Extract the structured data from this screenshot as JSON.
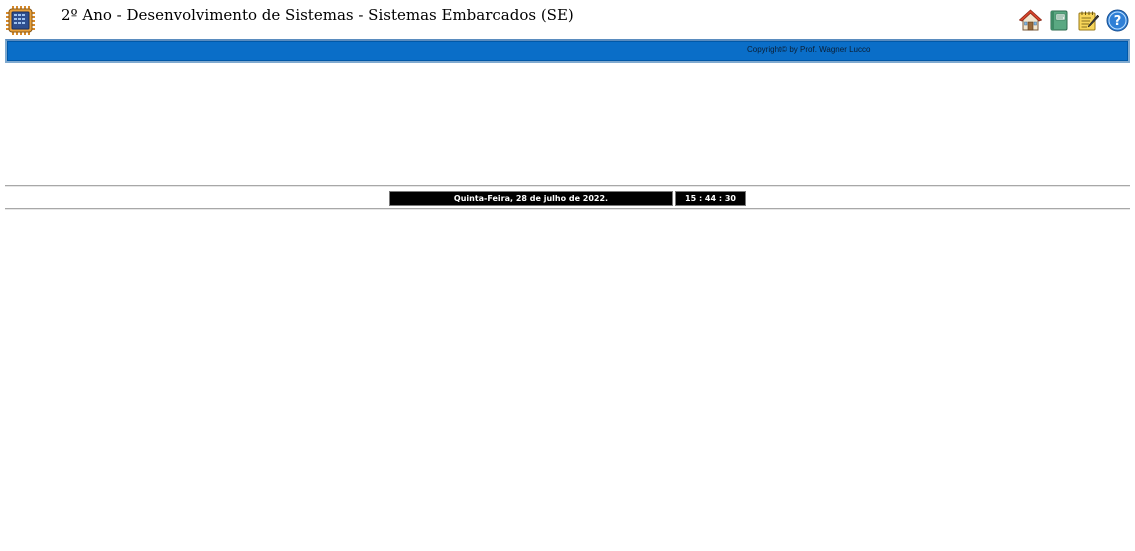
{
  "header": {
    "title": "2º Ano - Desenvolvimento de Sistemas - Sistemas Embarcados (SE)",
    "logo_icon": "microchip-icon",
    "nav_icons": [
      "home-icon",
      "book-icon",
      "notes-icon",
      "help-icon"
    ]
  },
  "banner": {
    "copyright": "Copyright© by Prof. Wagner Lucco",
    "color": "#0a6ec8"
  },
  "datetime": {
    "date": "Quinta-Feira, 28 de julho de 2022.",
    "time": "15 : 44 : 30"
  }
}
